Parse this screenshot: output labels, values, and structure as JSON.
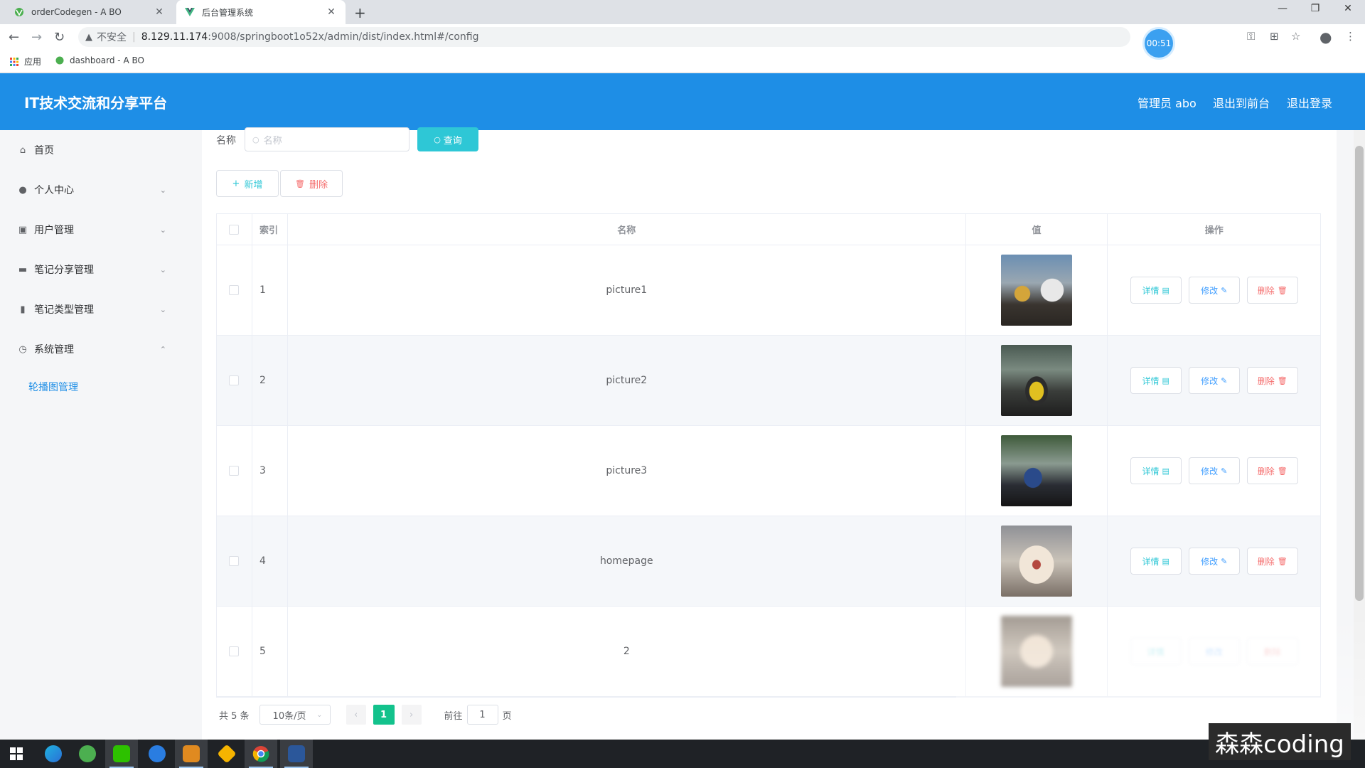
{
  "browser": {
    "tabs": [
      {
        "title": "orderCodegen - A BO"
      },
      {
        "title": "后台管理系统"
      }
    ],
    "address": {
      "security_label": "不安全",
      "host": "8.129.11.174",
      "path": ":9008/springboot1o52x/admin/dist/index.html#/config"
    },
    "timer": "00:51",
    "bookmarks": [
      {
        "label": "应用"
      },
      {
        "label": "dashboard - A BO"
      }
    ]
  },
  "header": {
    "title": "IT技术交流和分享平台",
    "user": "管理员 abo",
    "front_link": "退出到前台",
    "logout_link": "退出登录"
  },
  "sidebar": {
    "items": [
      {
        "label": "首页",
        "icon": "home-icon"
      },
      {
        "label": "个人中心",
        "icon": "user-icon"
      },
      {
        "label": "用户管理",
        "icon": "users-icon"
      },
      {
        "label": "笔记分享管理",
        "icon": "briefcase-icon"
      },
      {
        "label": "笔记类型管理",
        "icon": "notebook-icon"
      },
      {
        "label": "系统管理",
        "icon": "system-icon"
      }
    ],
    "submenu": {
      "label": "轮播图管理"
    }
  },
  "search": {
    "label": "名称",
    "placeholder": "名称",
    "button": "查询"
  },
  "actions": {
    "add": "新增",
    "delete": "删除"
  },
  "table": {
    "headers": {
      "index": "索引",
      "name": "名称",
      "value": "值",
      "ops": "操作"
    },
    "rows": [
      {
        "index": "1",
        "name": "picture1",
        "image": "cars-racing"
      },
      {
        "index": "2",
        "name": "picture2",
        "image": "yellow-car"
      },
      {
        "index": "3",
        "name": "picture3",
        "image": "blue-car"
      },
      {
        "index": "4",
        "name": "homepage",
        "image": "yawning-cat"
      },
      {
        "index": "5",
        "name": "2",
        "image": "cat-blurred"
      }
    ],
    "ops": {
      "detail": "详情",
      "edit": "修改",
      "delete": "删除"
    }
  },
  "pagination": {
    "total": "共 5 条",
    "page_size": "10条/页",
    "current": "1",
    "goto_label": "前往",
    "goto_value": "1",
    "page_suffix": "页"
  },
  "watermark": "森森coding",
  "colors": {
    "header_bg": "#1e8ee6",
    "accent_teal": "#2ec7d6",
    "danger": "#f56c6c",
    "page_current": "#13c28c"
  }
}
